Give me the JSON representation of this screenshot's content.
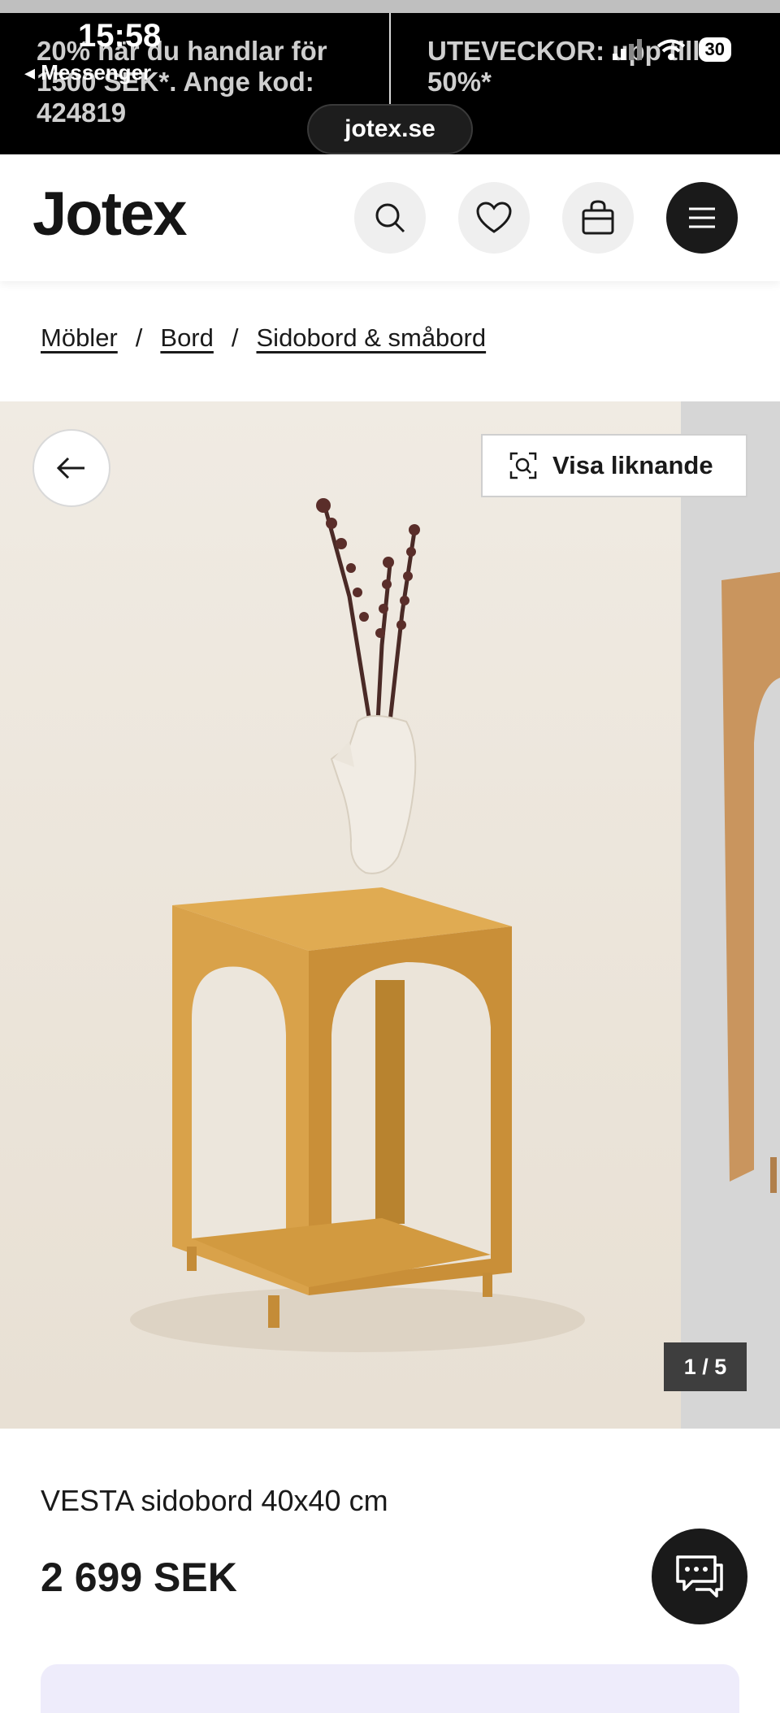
{
  "status_bar": {
    "time": "15:58",
    "back_app": "◂ Messenger",
    "battery": "30"
  },
  "promo": {
    "left_text": "20% när du handlar för 1500 SEK*. Ange kod: 424819",
    "right_text": "UTEVECKOR: upp till 50%*"
  },
  "url_bar": {
    "domain": "jotex.se"
  },
  "header": {
    "logo": "Jotex",
    "icons": [
      "search-icon",
      "heart-icon",
      "bag-icon",
      "menu-icon"
    ]
  },
  "breadcrumb": {
    "items": [
      "Möbler",
      "Bord",
      "Sidobord & småbord"
    ],
    "separator": "/"
  },
  "gallery": {
    "similar_label": "Visa liknande",
    "counter": "1 / 5"
  },
  "product": {
    "title": "VESTA sidobord 40x40 cm",
    "price": "2 699 SEK"
  },
  "colors": {
    "table": "#d9a24a",
    "table_shadow": "#b8832f",
    "background": "#ece6dc",
    "accent_dark": "#1a1a1a"
  }
}
